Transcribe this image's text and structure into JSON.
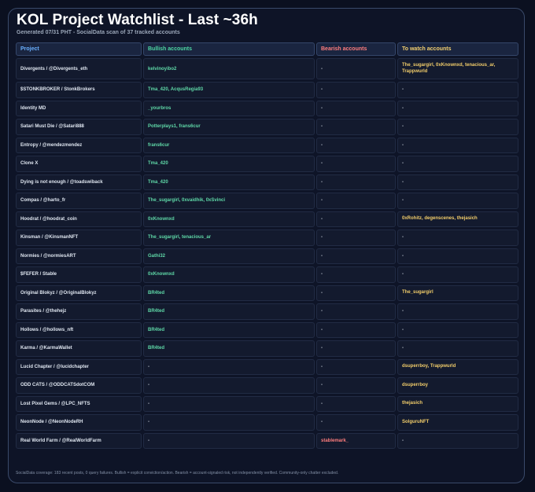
{
  "title": "KOL Project Watchlist - Last ~36h",
  "subtitle": "Generated 07/31 PHT - SocialData scan of 37 tracked accounts",
  "columns": {
    "project": "Project",
    "bullish": "Bullish accounts",
    "bearish": "Bearish accounts",
    "watch": "To watch accounts"
  },
  "rows": [
    {
      "project": "Divergents / @Divergents_eth",
      "bullish": "kelvinoyibo2",
      "bearish": "-",
      "watch": "The_sugargirl, 0xKnownxd, tenacious_ar, Trappwurld"
    },
    {
      "project": "$STONKBROKER / StonkBrokers",
      "bullish": "Tma_420, AcqusRegia93",
      "bearish": "-",
      "watch": "-"
    },
    {
      "project": "Identity MD",
      "bullish": "_yourbros",
      "bearish": "-",
      "watch": "-"
    },
    {
      "project": "Satari Must Die / @Satari888",
      "bullish": "Potterplays1, frans6cur",
      "bearish": "-",
      "watch": "-"
    },
    {
      "project": "Entropy / @mendezmendez",
      "bullish": "frans6cur",
      "bearish": "-",
      "watch": "-"
    },
    {
      "project": "Clone X",
      "bullish": "Tma_420",
      "bearish": "-",
      "watch": "-"
    },
    {
      "project": "Dying is not enough / @toadswiback",
      "bullish": "Tma_420",
      "bearish": "-",
      "watch": "-"
    },
    {
      "project": "Compas / @harto_fr",
      "bullish": "The_sugargirl, 0xvaidhik, 0xSvinci",
      "bearish": "-",
      "watch": "-"
    },
    {
      "project": "Hoodrat / @hoodrat_coin",
      "bullish": "0xKnownxd",
      "bearish": "-",
      "watch": "0xRohitz, degenscenes, thejasich"
    },
    {
      "project": "Kinsman / @KinsmanNFT",
      "bullish": "The_sugargirl, tenacious_ar",
      "bearish": "-",
      "watch": "-"
    },
    {
      "project": "Normies / @normiesART",
      "bullish": "Gathi32",
      "bearish": "-",
      "watch": "-"
    },
    {
      "project": "$FEFER / Stable",
      "bullish": "0xKnownxd",
      "bearish": "-",
      "watch": "-"
    },
    {
      "project": "Original Blokyz / @OriginalBlokyz",
      "bullish": "BR4ted",
      "bearish": "-",
      "watch": "The_sugargirl"
    },
    {
      "project": "Parasites / @thehejz",
      "bullish": "BR4ted",
      "bearish": "-",
      "watch": "-"
    },
    {
      "project": "Hollows / @hollows_nft",
      "bullish": "BR4ted",
      "bearish": "-",
      "watch": "-"
    },
    {
      "project": "Karma / @KarmaWallet",
      "bullish": "BR4ted",
      "bearish": "-",
      "watch": "-"
    },
    {
      "project": "Lucid Chapter / @lucidchapter",
      "bullish": "-",
      "bearish": "-",
      "watch": "dsuperrboy, Trappwurld"
    },
    {
      "project": "ODD CATS / @ODDCATSdotCOM",
      "bullish": "-",
      "bearish": "-",
      "watch": "dsuperrboy"
    },
    {
      "project": "Lost Pixel Gems / @LPC_NFTS",
      "bullish": "-",
      "bearish": "-",
      "watch": "thejasich"
    },
    {
      "project": "NeonNode / @NeonNodeRH",
      "bullish": "-",
      "bearish": "-",
      "watch": "SolguruNFT"
    },
    {
      "project": "Real World Farm / @RealWorldFarm",
      "bullish": "-",
      "bearish": "stablemark_",
      "watch": "-"
    }
  ],
  "footnote": "SocialData coverage: 183 recent posts, 0 query failures. Bullish = explicit conviction/action. Bearish = account-signaled risk, not independently verified. Community-only chatter excluded.",
  "colors": {
    "background": "#0b1020",
    "panel": "#0e1427",
    "project_header": "#6ab0ff",
    "bullish": "#4dd8a3",
    "bearish": "#ff7d7d",
    "watch": "#f4d06f"
  }
}
